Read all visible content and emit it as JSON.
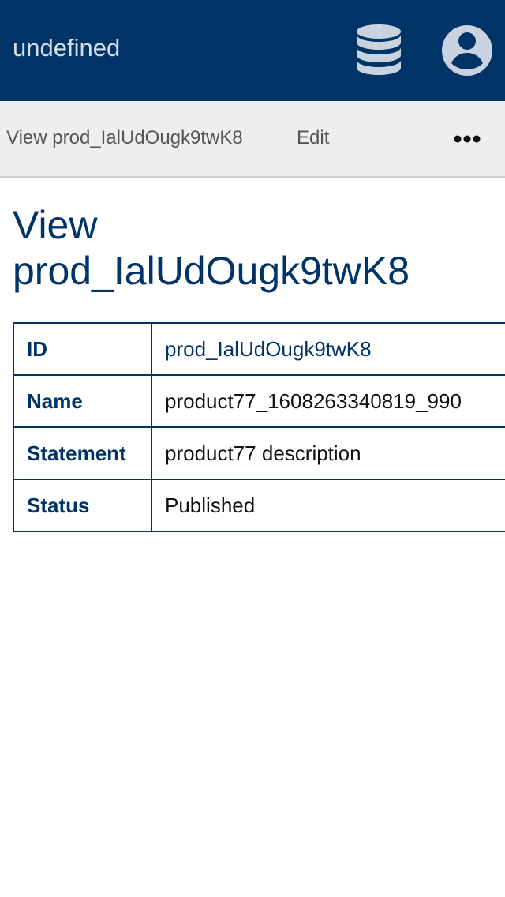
{
  "header": {
    "app_title": "undefined",
    "icons": {
      "database": "database-icon",
      "user": "user-circle-icon"
    },
    "colors": {
      "background": "#003366",
      "icon": "#c9d3df"
    }
  },
  "subnav": {
    "view_label": "View prod_IalUdOugk9twK8",
    "edit_label": "Edit",
    "more_icon": "more-horizontal-icon"
  },
  "page": {
    "title": "View prod_IalUdOugk9twK8"
  },
  "details": {
    "rows": [
      {
        "key": "ID",
        "value": "prod_IalUdOugk9twK8",
        "link": true
      },
      {
        "key": "Name",
        "value": "product77_1608263340819_990",
        "link": false
      },
      {
        "key": "Statement",
        "value": "product77 description",
        "link": false
      },
      {
        "key": "Status",
        "value": "Published",
        "link": false
      }
    ]
  }
}
